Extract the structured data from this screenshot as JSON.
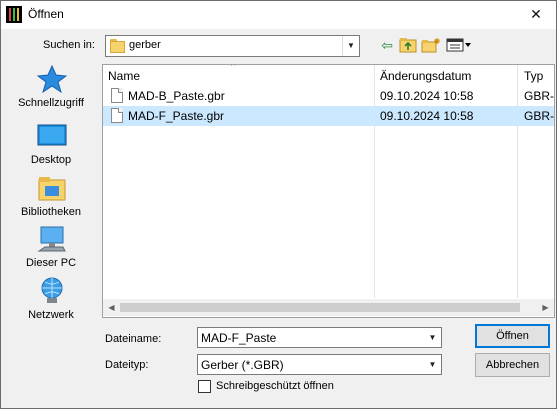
{
  "window": {
    "title": "Öffnen",
    "close_glyph": "✕"
  },
  "lookin": {
    "label": "Suchen in:",
    "value": "gerber"
  },
  "toolbar": {
    "back": "⇦",
    "up": "⬆",
    "new_folder": "✱",
    "views": "▦▾"
  },
  "places": [
    {
      "label": "Schnellzugriff",
      "icon": "star-icon"
    },
    {
      "label": "Desktop",
      "icon": "desktop-icon"
    },
    {
      "label": "Bibliotheken",
      "icon": "libraries-icon"
    },
    {
      "label": "Dieser PC",
      "icon": "computer-icon"
    },
    {
      "label": "Netzwerk",
      "icon": "network-icon"
    }
  ],
  "list": {
    "headers": {
      "name": "Name",
      "date": "Änderungsdatum",
      "type": "Typ",
      "sort_caret": "^"
    },
    "rows": [
      {
        "name": "MAD-B_Paste.gbr",
        "date": "09.10.2024 10:58",
        "type": "GBR-",
        "selected": false
      },
      {
        "name": "MAD-F_Paste.gbr",
        "date": "09.10.2024 10:58",
        "type": "GBR-",
        "selected": true
      }
    ]
  },
  "filename": {
    "label": "Dateiname:",
    "value": "MAD-F_Paste"
  },
  "filetype": {
    "label": "Dateityp:",
    "value": "Gerber (*.GBR)"
  },
  "readonly": {
    "label": "Schreibgeschützt öffnen",
    "checked": false
  },
  "buttons": {
    "open": "Öffnen",
    "cancel": "Abbrechen"
  },
  "scroll": {
    "left": "◀",
    "right": "▶",
    "down": "▼"
  },
  "colors": {
    "selection": "#cce8ff",
    "accent": "#0078d7"
  }
}
